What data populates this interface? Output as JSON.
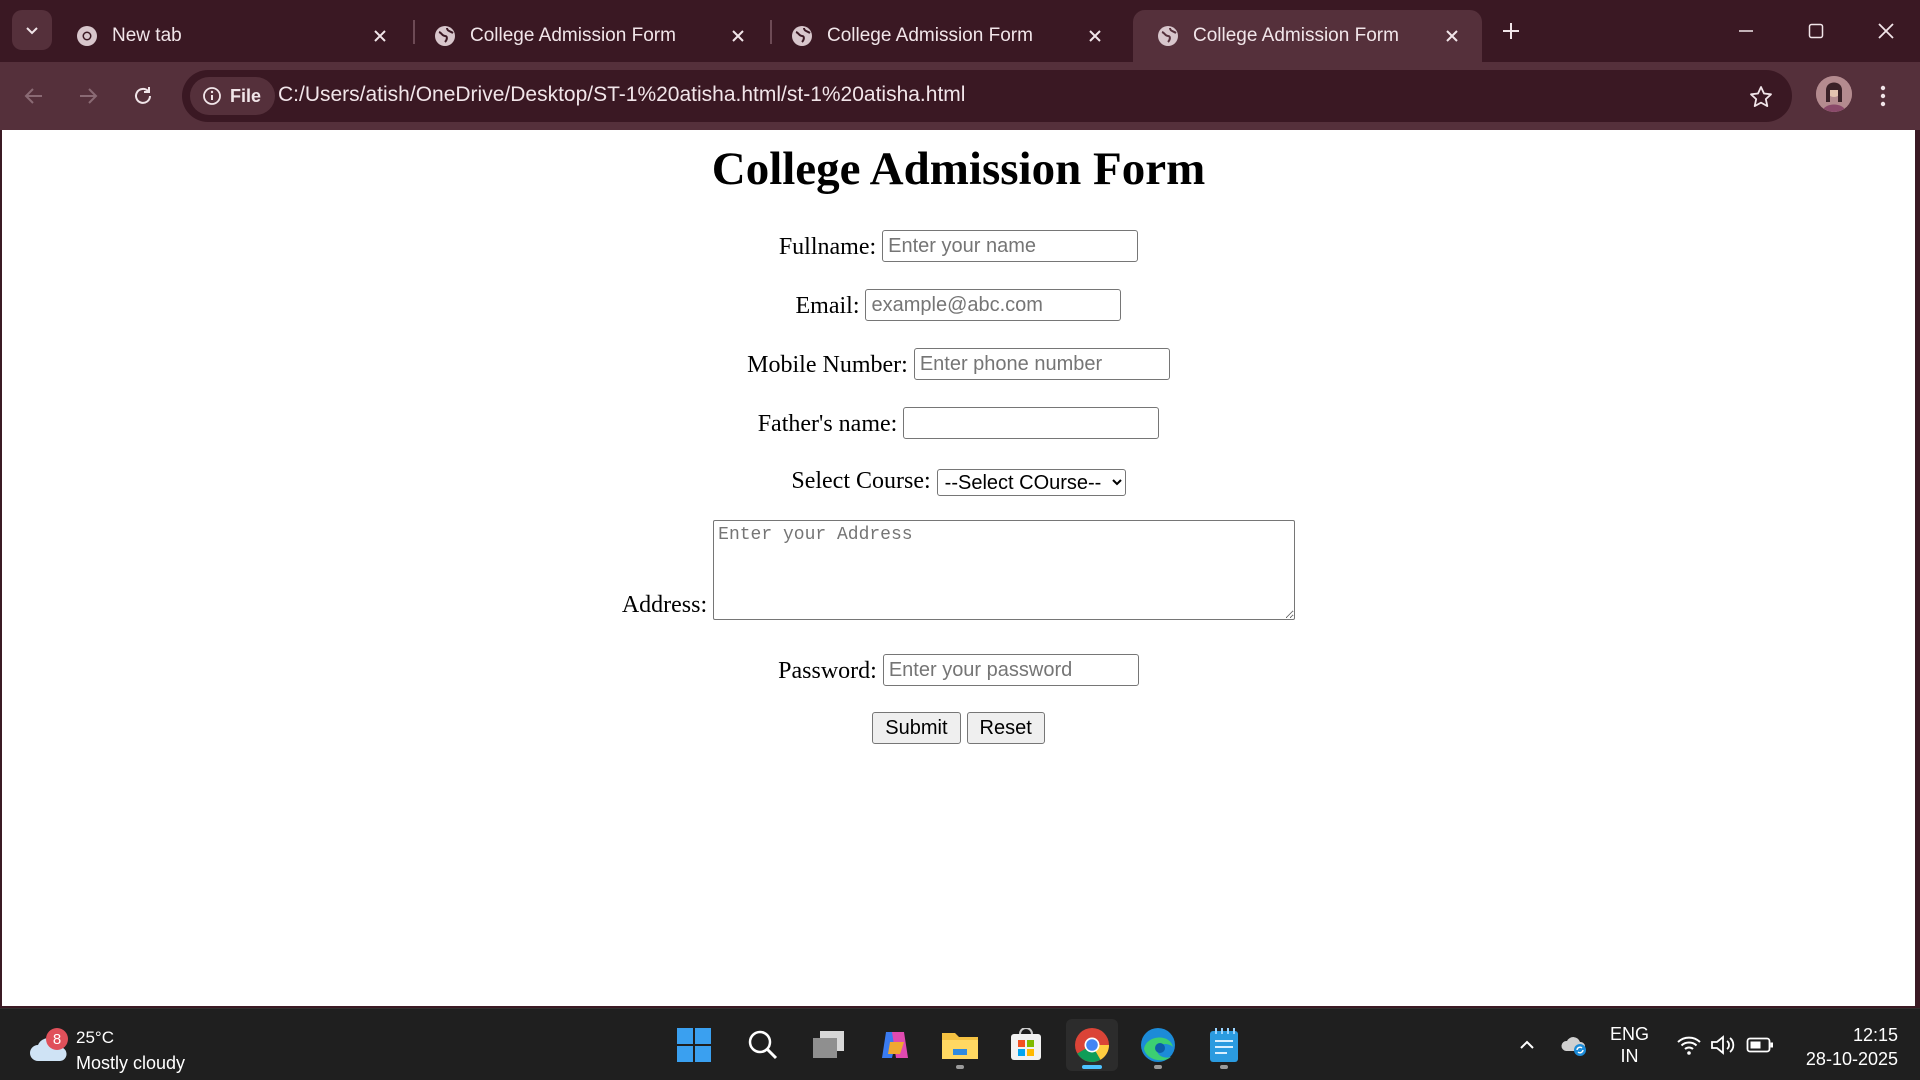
{
  "browser": {
    "tabs": [
      {
        "title": "New tab",
        "icon": "chrome-icon",
        "active": false
      },
      {
        "title": "College Admission Form",
        "icon": "globe-icon",
        "active": false
      },
      {
        "title": "College Admission Form",
        "icon": "globe-icon",
        "active": false
      },
      {
        "title": "College Admission Form",
        "icon": "globe-icon",
        "active": true
      }
    ],
    "address_chip": "File",
    "url": "C:/Users/atish/OneDrive/Desktop/ST-1%20atisha.html/st-1%20atisha.html"
  },
  "form": {
    "title": "College Admission Form",
    "fullname": {
      "label": "Fullname:",
      "placeholder": "Enter your name"
    },
    "email": {
      "label": "Email:",
      "placeholder": "example@abc.com"
    },
    "mobile": {
      "label": "Mobile Number:",
      "placeholder": "Enter phone number"
    },
    "father": {
      "label": "Father's name:",
      "placeholder": ""
    },
    "course": {
      "label": "Select Course:",
      "selected": "--Select COurse--"
    },
    "address": {
      "label": "Address:",
      "placeholder": "Enter your Address"
    },
    "password": {
      "label": "Password:",
      "placeholder": "Enter your password"
    },
    "submit_label": "Submit",
    "reset_label": "Reset"
  },
  "taskbar": {
    "weather": {
      "badge": "8",
      "temp": "25°C",
      "desc": "Mostly cloudy"
    },
    "lang_top": "ENG",
    "lang_bottom": "IN",
    "time": "12:15",
    "date": "28-10-2025"
  },
  "colors": {
    "titlebar": "#3a1823",
    "toolbar": "#55303b",
    "accent": "#4cc2ff"
  }
}
